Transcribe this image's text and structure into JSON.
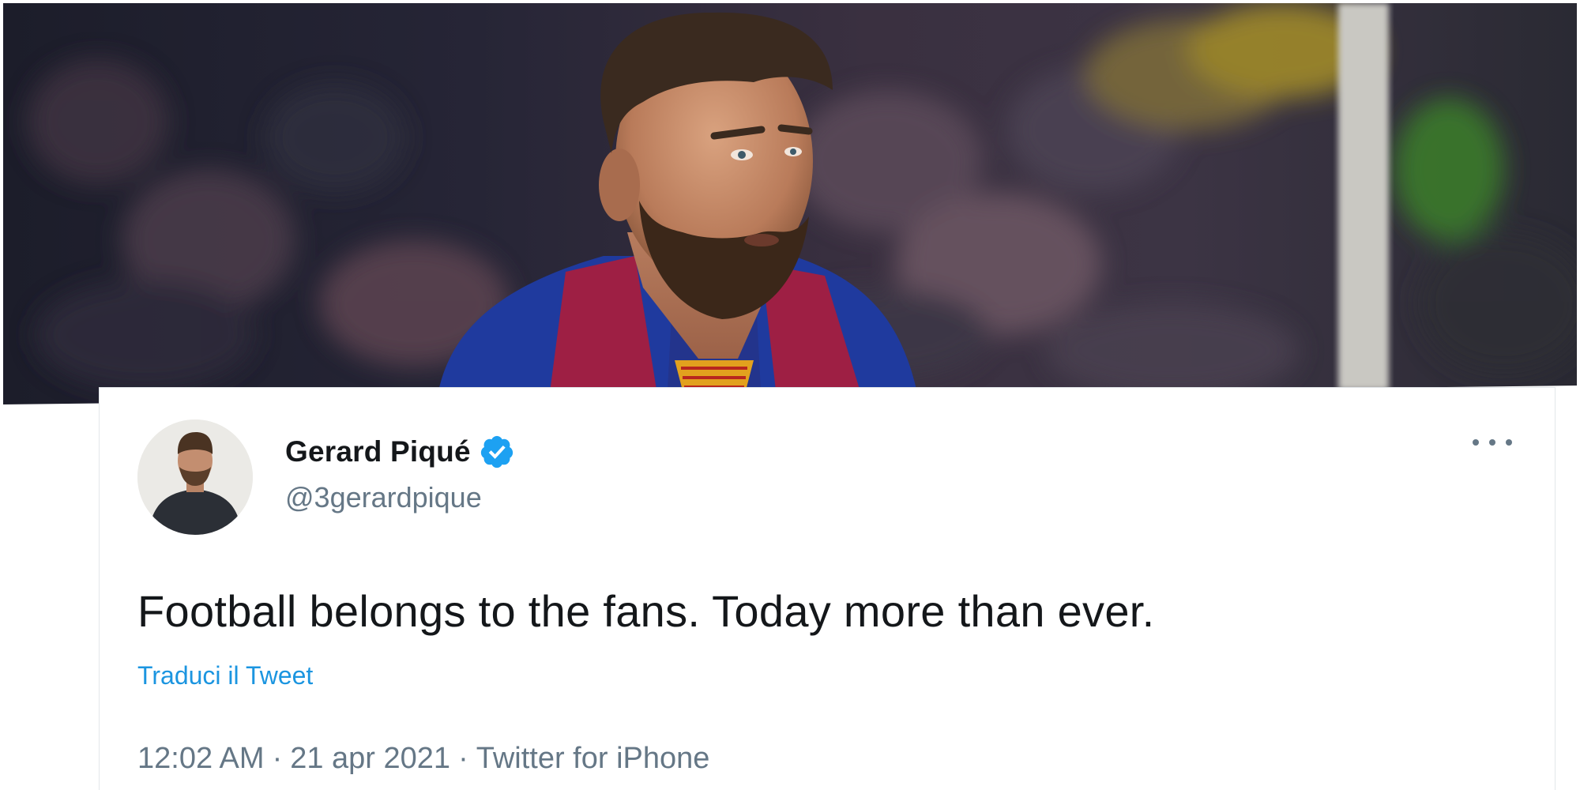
{
  "tweet": {
    "author_name": "Gerard Piqué",
    "handle": "@3gerardpique",
    "text": "Football belongs to the fans. Today more than ever.",
    "translate_label": "Traduci il Tweet",
    "time": "12:02 AM",
    "date": "21 apr 2021",
    "source": "Twitter for iPhone",
    "separator": "·",
    "verified": true
  },
  "icons": {
    "verified": "verified-badge-icon",
    "more": "more-options-icon"
  },
  "colors": {
    "link": "#1b95e0",
    "verified_badge": "#1da1f2",
    "secondary_text": "#657786",
    "primary_text": "#14171a"
  }
}
